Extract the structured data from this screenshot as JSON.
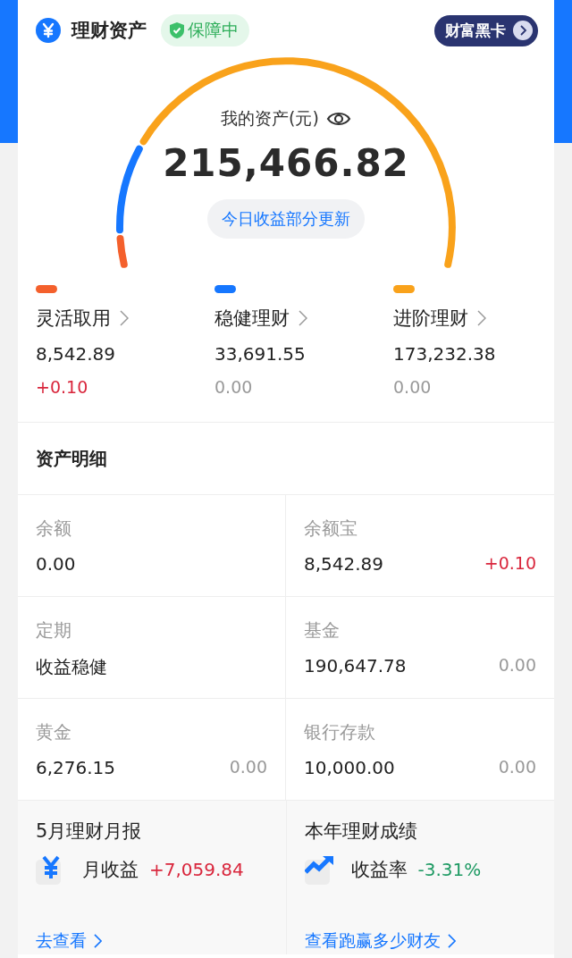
{
  "header": {
    "title": "理财资产",
    "badge": "保障中",
    "card_button": "财富黑卡"
  },
  "summary": {
    "label": "我的资产(元)",
    "total": "215,466.82",
    "note": "今日收益部分更新"
  },
  "categories": [
    {
      "name": "灵活取用",
      "color": "#f4602c",
      "amount": "8,542.89",
      "change": "+0.10",
      "kind": "gain"
    },
    {
      "name": "稳健理财",
      "color": "#1677ff",
      "amount": "33,691.55",
      "change": "0.00",
      "kind": "flat"
    },
    {
      "name": "进阶理财",
      "color": "#f9a21b",
      "amount": "173,232.38",
      "change": "0.00",
      "kind": "flat"
    }
  ],
  "details": {
    "title": "资产明细",
    "items": [
      {
        "label": "余额",
        "value": "0.00"
      },
      {
        "label": "余额宝",
        "value": "8,542.89",
        "change": "+0.10",
        "kind": "gain"
      },
      {
        "label": "定期",
        "value": "收益稳健"
      },
      {
        "label": "基金",
        "value": "190,647.78",
        "change": "0.00",
        "kind": "flat"
      },
      {
        "label": "黄金",
        "value": "6,276.15",
        "change": "0.00",
        "kind": "flat"
      },
      {
        "label": "银行存款",
        "value": "10,000.00",
        "change": "0.00",
        "kind": "flat"
      }
    ]
  },
  "reports": [
    {
      "title": "5月理财月报",
      "kind": "monthly",
      "label": "月收益",
      "value": "+7,059.84",
      "color": "#d9263c",
      "link": "去查看"
    },
    {
      "title": "本年理财成绩",
      "kind": "yearly",
      "label": "收益率",
      "value": "-3.31%",
      "color": "#1e9a63",
      "link": "查看跑赢多少财友"
    }
  ]
}
